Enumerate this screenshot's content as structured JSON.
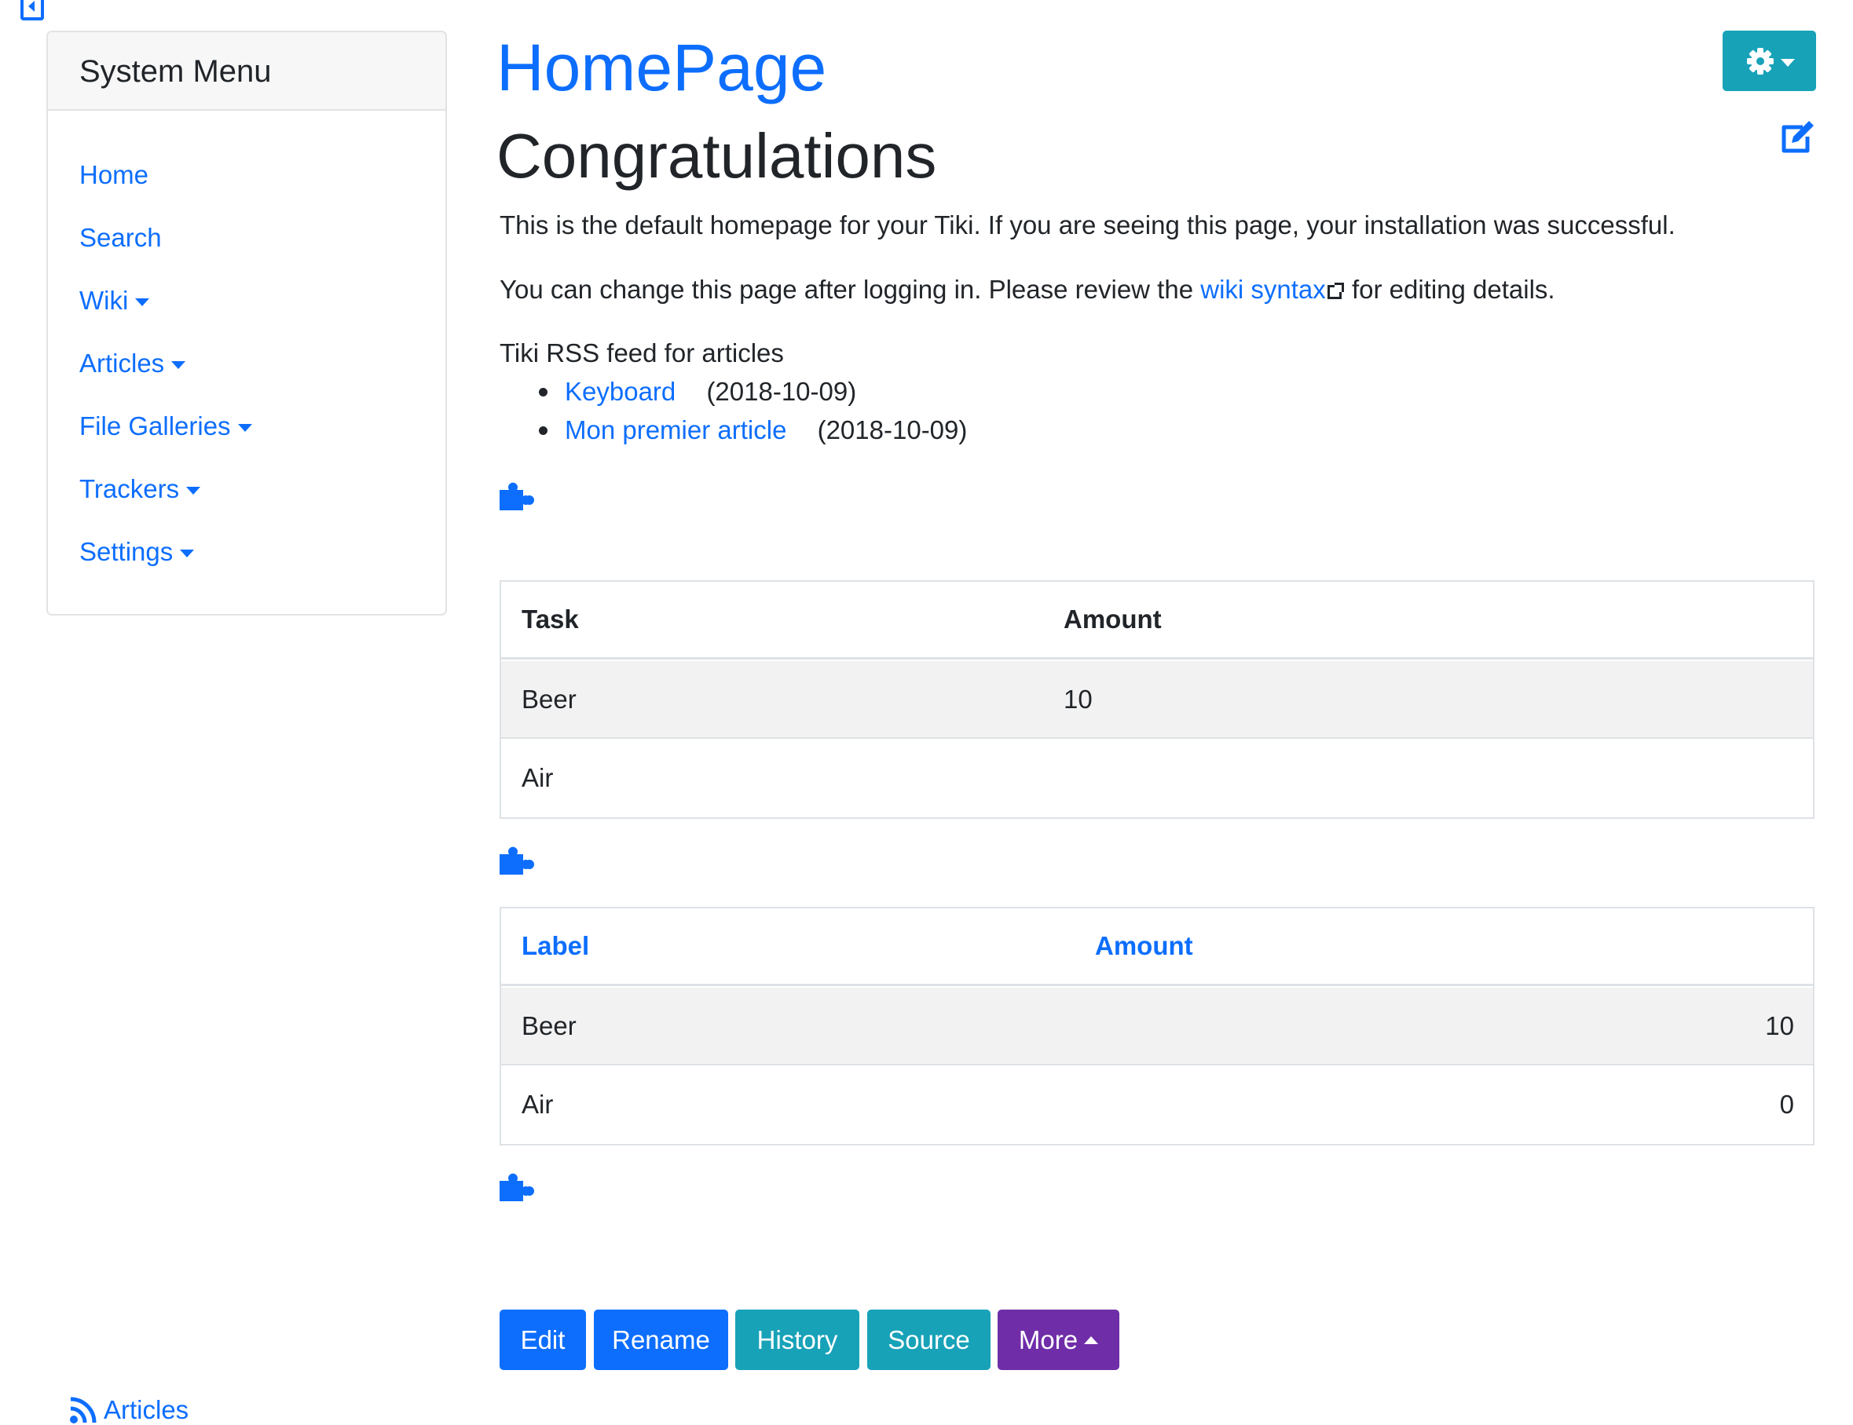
{
  "sidebar": {
    "title": "System Menu",
    "items": [
      {
        "label": "Home",
        "dropdown": false
      },
      {
        "label": "Search",
        "dropdown": false
      },
      {
        "label": "Wiki",
        "dropdown": true
      },
      {
        "label": "Articles",
        "dropdown": true
      },
      {
        "label": "File Galleries",
        "dropdown": true
      },
      {
        "label": "Trackers",
        "dropdown": true
      },
      {
        "label": "Settings",
        "dropdown": true
      }
    ],
    "rss_label": "Articles"
  },
  "page": {
    "title": "HomePage",
    "heading": "Congratulations",
    "intro": "This is the default homepage for your Tiki. If you are seeing this page, your installation was successful.",
    "change_prefix": "You can change this page after logging in. Please review the",
    "syntax_link": "wiki syntax",
    "change_suffix": "for editing details.",
    "rss_feed_link": "Tiki RSS feed for articles",
    "articles": [
      {
        "title": "Keyboard",
        "date": "(2018-10-09)"
      },
      {
        "title": "Mon premier article",
        "date": "(2018-10-09)"
      }
    ]
  },
  "table1": {
    "headers": [
      "Task",
      "Amount"
    ],
    "rows": [
      [
        "Beer",
        "10"
      ],
      [
        "Air",
        ""
      ]
    ]
  },
  "table2": {
    "headers": [
      "Label",
      "Amount"
    ],
    "rows": [
      [
        "Beer",
        "10"
      ],
      [
        "Air",
        "0"
      ]
    ]
  },
  "actions": {
    "edit": "Edit",
    "rename": "Rename",
    "history": "History",
    "source": "Source",
    "more": "More"
  },
  "icons": {
    "collapse": "sidebar-collapse-icon",
    "cog": "gear-icon",
    "edit": "edit-icon",
    "puzzle": "puzzle-icon",
    "rss": "rss-icon"
  },
  "colors": {
    "link": "#0d6efd",
    "primary": "#0d6efd",
    "info": "#17a2b8",
    "purple": "#6f2da8"
  }
}
